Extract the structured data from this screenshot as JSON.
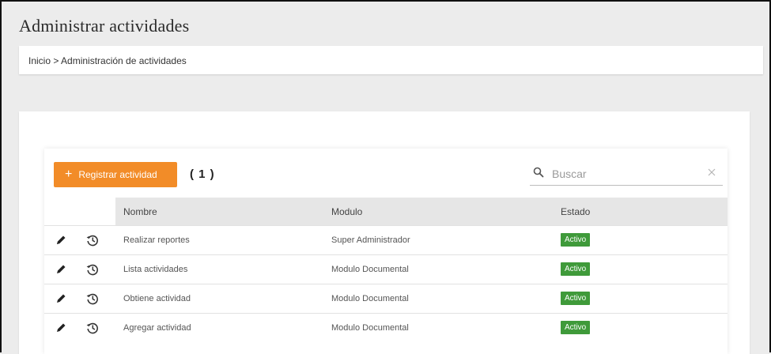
{
  "page": {
    "title": "Administrar actividades"
  },
  "breadcrumb": {
    "text": "Inicio > Administración de actividades"
  },
  "toolbar": {
    "register_plus": "+",
    "register_label": "Registrar actividad",
    "count": "( 1 )"
  },
  "search": {
    "placeholder": "Buscar",
    "icon": "search-icon",
    "clear_icon": "close-icon"
  },
  "table": {
    "headers": {
      "nombre": "Nombre",
      "modulo": "Modulo",
      "estado": "Estado"
    },
    "rows": [
      {
        "nombre": "Realizar reportes",
        "modulo": "Super Administrador",
        "estado": "Activo"
      },
      {
        "nombre": "Lista actividades",
        "modulo": "Modulo Documental",
        "estado": "Activo"
      },
      {
        "nombre": "Obtiene actividad",
        "modulo": "Modulo Documental",
        "estado": "Activo"
      },
      {
        "nombre": "Agregar actividad",
        "modulo": "Modulo Documental",
        "estado": "Activo"
      }
    ]
  },
  "colors": {
    "accent": "#f28c28",
    "status_active": "#3f9a3a",
    "header_bg": "#e6e6e6"
  },
  "icons": {
    "row_edit": "pencil-icon",
    "row_history": "history-icon"
  }
}
